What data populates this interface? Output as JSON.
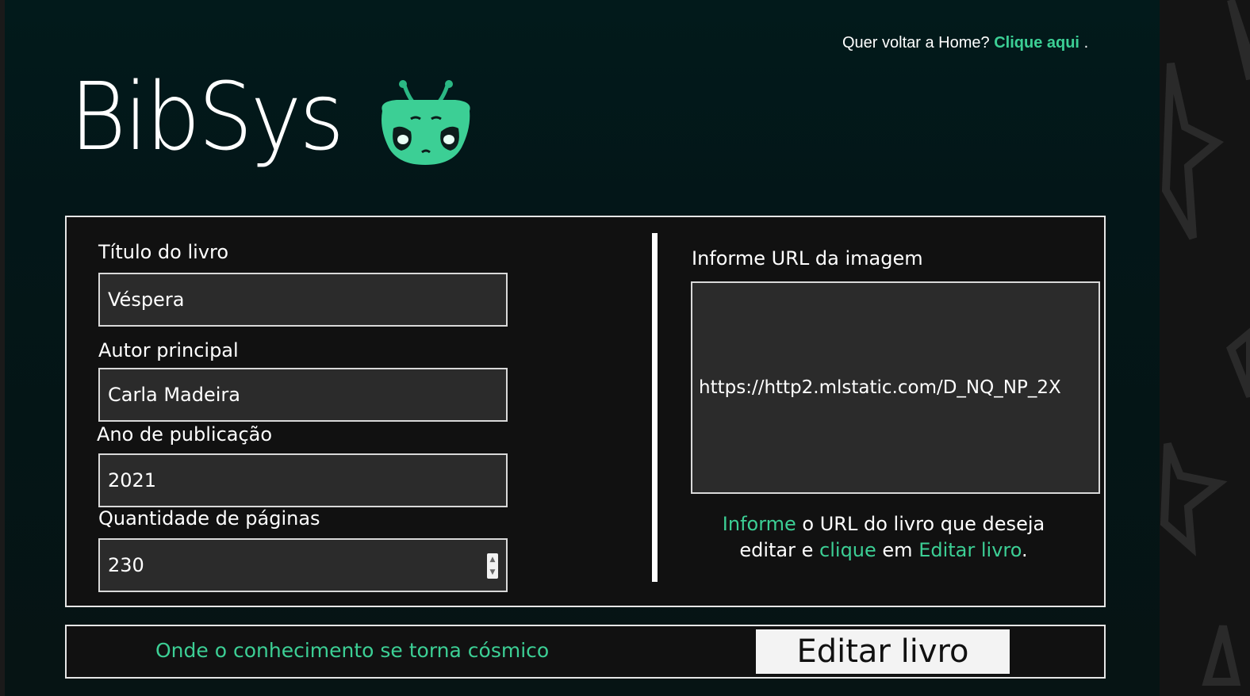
{
  "header": {
    "home_prompt": "Quer voltar a Home?",
    "home_link": "Clique aqui",
    "home_suffix": "."
  },
  "brand": {
    "logo_text": "BibSys",
    "mascot_icon": "alien-mascot-icon",
    "accent_color": "#3ccf95"
  },
  "form": {
    "title_label": "Título do livro",
    "title_value": "Véspera",
    "author_label": "Autor principal",
    "author_value": "Carla Madeira",
    "year_label": "Ano de publicação",
    "year_value": "2021",
    "pages_label": "Quantidade de páginas",
    "pages_value": "230",
    "image_url_label": "Informe URL da imagem",
    "image_url_value": "https://http2.mlstatic.com/D_NQ_NP_2X"
  },
  "hint": {
    "w1": "Informe",
    "t1": " o URL do livro que deseja editar e ",
    "w2": "clique",
    "t2": " em ",
    "w3": "Editar livro",
    "t3": "."
  },
  "footer": {
    "tagline": "Onde o conhecimento se torna cósmico",
    "submit_label": "Editar livro"
  }
}
